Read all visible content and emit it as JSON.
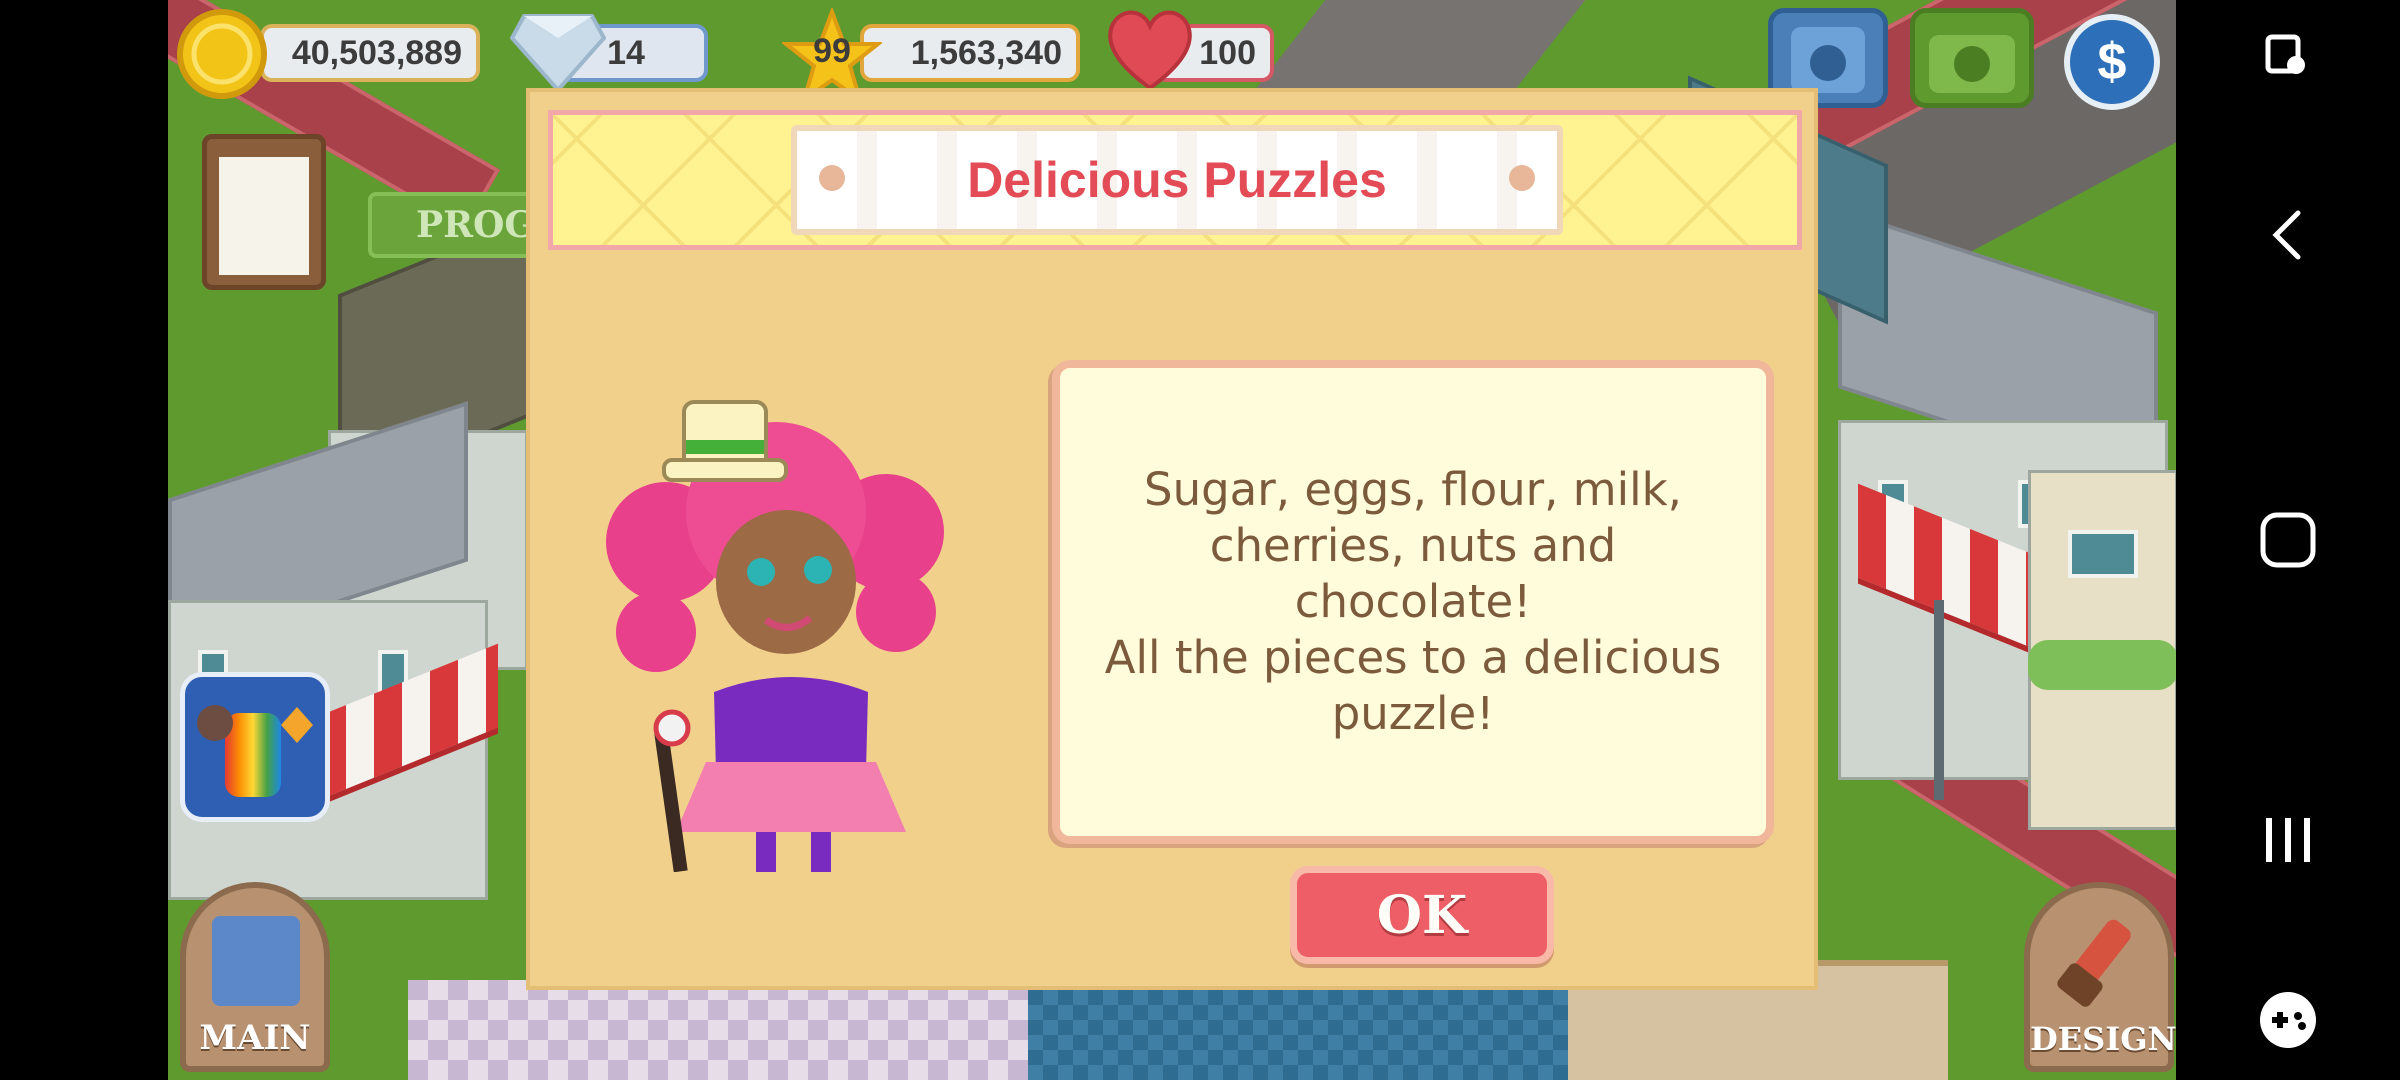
{
  "hud": {
    "coins": "40,503,889",
    "gems": "14",
    "level": "99",
    "xp": "1,563,340",
    "hearts": "100"
  },
  "left_buttons": {
    "progress_label": "PROG",
    "main_label": "MAIN"
  },
  "right_buttons": {
    "design_label": "DESIGN"
  },
  "dialog": {
    "title": "Delicious Puzzles",
    "message_lines": [
      "Sugar, eggs, flour, milk,",
      "cherries, nuts and chocolate!",
      "All the pieces to a delicious",
      "puzzle!"
    ],
    "ok_label": "OK"
  },
  "colors": {
    "dialog_bg": "#f1d08c",
    "title_color": "#e34c57",
    "ok_button": "#ee5e66",
    "message_text": "#7c5a3c"
  },
  "icons": [
    "coin-icon",
    "diamond-icon",
    "star-icon",
    "heart-icon",
    "phone-icon",
    "camera-icon",
    "currency-icon",
    "clipboard-icon",
    "puzzle-game-icon",
    "paint-brush-icon",
    "book-icon"
  ]
}
